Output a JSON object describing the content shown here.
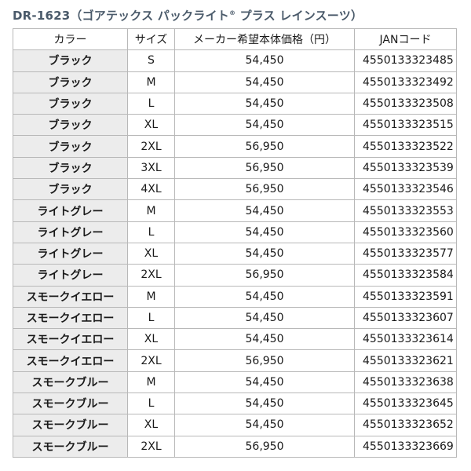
{
  "title": {
    "main": "DR-1623（ゴアテックス パックライト",
    "mark": "®",
    "rest": " プラス レインスーツ）"
  },
  "table": {
    "headers": {
      "color": "カラー",
      "size": "サイズ",
      "price": "メーカー希望本体価格（円）",
      "jan": "JANコード"
    },
    "rows": [
      {
        "color": "ブラック",
        "size": "S",
        "price": "54,450",
        "jan": "4550133323485"
      },
      {
        "color": "ブラック",
        "size": "M",
        "price": "54,450",
        "jan": "4550133323492"
      },
      {
        "color": "ブラック",
        "size": "L",
        "price": "54,450",
        "jan": "4550133323508"
      },
      {
        "color": "ブラック",
        "size": "XL",
        "price": "54,450",
        "jan": "4550133323515"
      },
      {
        "color": "ブラック",
        "size": "2XL",
        "price": "56,950",
        "jan": "4550133323522"
      },
      {
        "color": "ブラック",
        "size": "3XL",
        "price": "56,950",
        "jan": "4550133323539"
      },
      {
        "color": "ブラック",
        "size": "4XL",
        "price": "56,950",
        "jan": "4550133323546"
      },
      {
        "color": "ライトグレー",
        "size": "M",
        "price": "54,450",
        "jan": "4550133323553"
      },
      {
        "color": "ライトグレー",
        "size": "L",
        "price": "54,450",
        "jan": "4550133323560"
      },
      {
        "color": "ライトグレー",
        "size": "XL",
        "price": "54,450",
        "jan": "4550133323577"
      },
      {
        "color": "ライトグレー",
        "size": "2XL",
        "price": "56,950",
        "jan": "4550133323584"
      },
      {
        "color": "スモークイエロー",
        "size": "M",
        "price": "54,450",
        "jan": "4550133323591"
      },
      {
        "color": "スモークイエロー",
        "size": "L",
        "price": "54,450",
        "jan": "4550133323607"
      },
      {
        "color": "スモークイエロー",
        "size": "XL",
        "price": "54,450",
        "jan": "4550133323614"
      },
      {
        "color": "スモークイエロー",
        "size": "2XL",
        "price": "56,950",
        "jan": "4550133323621"
      },
      {
        "color": "スモークブルー",
        "size": "M",
        "price": "54,450",
        "jan": "4550133323638"
      },
      {
        "color": "スモークブルー",
        "size": "L",
        "price": "54,450",
        "jan": "4550133323645"
      },
      {
        "color": "スモークブルー",
        "size": "XL",
        "price": "54,450",
        "jan": "4550133323652"
      },
      {
        "color": "スモークブルー",
        "size": "2XL",
        "price": "56,950",
        "jan": "4550133323669"
      }
    ]
  }
}
